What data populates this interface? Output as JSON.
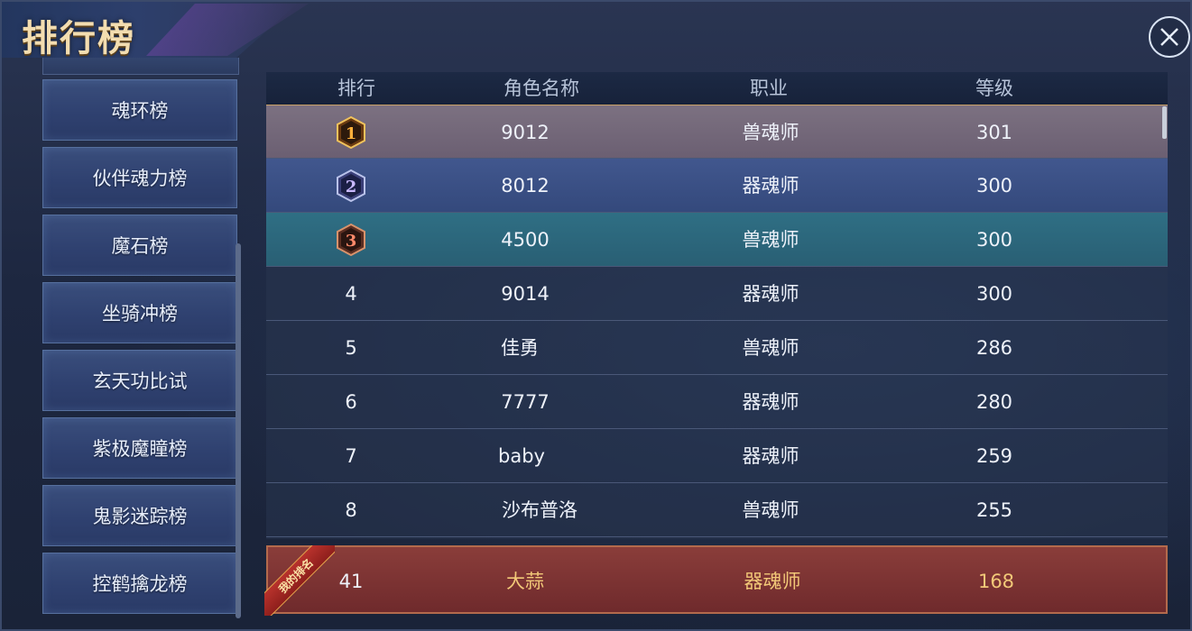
{
  "window": {
    "title": "排行榜"
  },
  "sidebar": {
    "items": [
      "魂环榜",
      "伙伴魂力榜",
      "魔石榜",
      "坐骑冲榜",
      "玄天功比试",
      "紫极魔瞳榜",
      "鬼影迷踪榜",
      "控鹤擒龙榜"
    ]
  },
  "table": {
    "headers": {
      "rank": "排行",
      "name": "角色名称",
      "job": "职业",
      "level": "等级"
    },
    "rows": [
      {
        "rank": "1",
        "name": "9012",
        "job": "兽魂师",
        "level": "301"
      },
      {
        "rank": "2",
        "name": "8012",
        "job": "器魂师",
        "level": "300"
      },
      {
        "rank": "3",
        "name": "4500",
        "job": "兽魂师",
        "level": "300"
      },
      {
        "rank": "4",
        "name": "9014",
        "job": "器魂师",
        "level": "300"
      },
      {
        "rank": "5",
        "name": "佳勇",
        "job": "兽魂师",
        "level": "286"
      },
      {
        "rank": "6",
        "name": "7777",
        "job": "器魂师",
        "level": "280"
      },
      {
        "rank": "7",
        "name": "baby",
        "job": "器魂师",
        "level": "259"
      },
      {
        "rank": "8",
        "name": "沙布普洛",
        "job": "兽魂师",
        "level": "255"
      }
    ]
  },
  "my_rank": {
    "tag": "我的排名",
    "rank": "41",
    "name": "大蒜",
    "job": "器魂师",
    "level": "168"
  },
  "icons": {
    "close": "close-icon",
    "medal_1": "gold-medal-icon",
    "medal_2": "silver-medal-icon",
    "medal_3": "bronze-medal-icon"
  },
  "colors": {
    "accent_gold": "#f3ddb0",
    "my_rank_text": "#f2c878",
    "my_rank_bg": "#6f2a2c"
  }
}
